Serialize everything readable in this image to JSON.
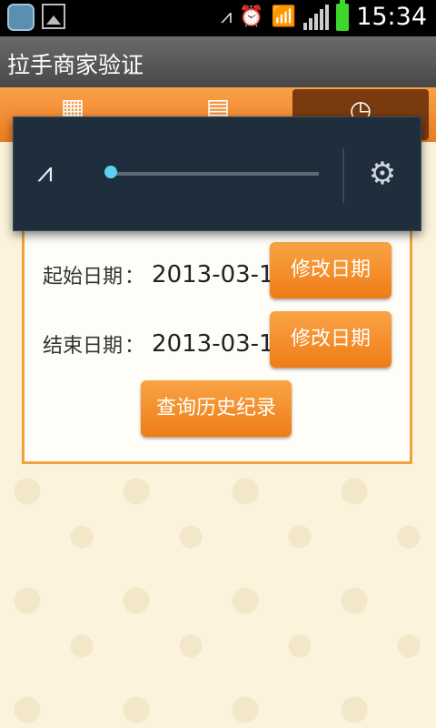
{
  "status_bar": {
    "time": "15:34",
    "icons": [
      "app-icon",
      "image-icon",
      "vibrate-icon",
      "alarm-icon",
      "wifi-icon",
      "signal-icon",
      "battery-icon"
    ]
  },
  "title_bar": {
    "title": "拉手商家验证"
  },
  "tabs": [
    {
      "icon": "qr-code-icon",
      "active": false
    },
    {
      "icon": "barcode-icon",
      "active": false
    },
    {
      "icon": "clock-icon",
      "active": true
    }
  ],
  "volume_panel": {
    "mute_icon": "vibrate-mute-icon",
    "slider_level": 0.03,
    "settings_icon": "gear-icon"
  },
  "form": {
    "start_label": "起始日期",
    "start_sep": "：",
    "start_date": "2013-03-15",
    "end_label": "结束日期",
    "end_sep": "：",
    "end_date": "2013-03-15",
    "edit_button_1": "修改日期",
    "edit_button_2": "修改日期",
    "query_button": "查询历史纪录"
  },
  "colors": {
    "accent_orange": "#ef7c16",
    "panel_bg": "#1f2e3c",
    "slider_thumb": "#5ed0f0",
    "page_bg": "#fbf3dc"
  }
}
